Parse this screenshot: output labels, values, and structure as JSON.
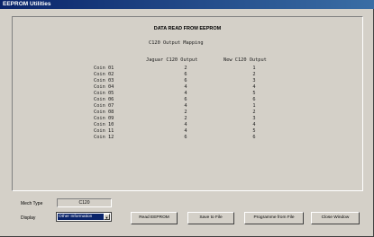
{
  "window": {
    "title": "EEPROM Utilities"
  },
  "panel": {
    "title": "DATA READ FROM EEPROM"
  },
  "mapping": {
    "title": "C120 Output Mapping",
    "col_jaguar": "Jaguar C120 Output",
    "col_new": "New C120 Output",
    "rows": [
      {
        "coin": "Coin 01",
        "jaguar": "2",
        "new": "1"
      },
      {
        "coin": "Coin 02",
        "jaguar": "6",
        "new": "2"
      },
      {
        "coin": "Coin 03",
        "jaguar": "6",
        "new": "3"
      },
      {
        "coin": "Coin 04",
        "jaguar": "4",
        "new": "4"
      },
      {
        "coin": "Coin 05",
        "jaguar": "4",
        "new": "5"
      },
      {
        "coin": "Coin 06",
        "jaguar": "6",
        "new": "6"
      },
      {
        "coin": "Coin 07",
        "jaguar": "4",
        "new": "1"
      },
      {
        "coin": "Coin 08",
        "jaguar": "2",
        "new": "2"
      },
      {
        "coin": "Coin 09",
        "jaguar": "2",
        "new": "3"
      },
      {
        "coin": "Coin 10",
        "jaguar": "4",
        "new": "4"
      },
      {
        "coin": "Coin 11",
        "jaguar": "4",
        "new": "5"
      },
      {
        "coin": "Coin 12",
        "jaguar": "6",
        "new": "6"
      }
    ]
  },
  "mech_type": {
    "label": "Mech Type",
    "value": "C120"
  },
  "display": {
    "label": "Display",
    "value": "Other Information"
  },
  "buttons": {
    "read": "Read EEPROM",
    "save": "Save to File",
    "program": "Programme from File",
    "close": "Close Window"
  }
}
